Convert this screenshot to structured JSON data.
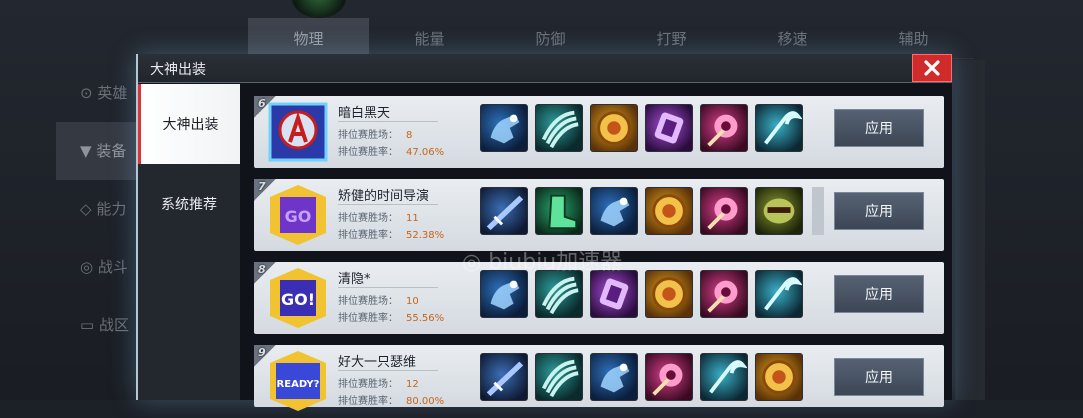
{
  "background": {
    "tabs": [
      "物理",
      "能量",
      "防御",
      "打野",
      "移速",
      "辅助"
    ],
    "side_items": [
      "英雄",
      "装备",
      "能力",
      "战斗",
      "战区"
    ]
  },
  "dialog": {
    "title": "大神出装",
    "close_icon": "close-icon",
    "nav": [
      "大神出装",
      "系统推荐"
    ]
  },
  "builds": [
    {
      "rank": "6",
      "name": "暗白黑天",
      "games_label": "排位赛胜场：",
      "games": "8",
      "winrate_label": "排位赛胜率：",
      "winrate": "47.06%",
      "avatar": "avengers-badge",
      "items": [
        "gauntlet",
        "claw",
        "coin",
        "purple",
        "pink",
        "scythe"
      ],
      "apply": "应用"
    },
    {
      "rank": "7",
      "name": "矫健的时间导演",
      "games_label": "排位赛胜场：",
      "games": "11",
      "winrate_label": "排位赛胜率：",
      "winrate": "52.38%",
      "avatar": "go-badge-purple",
      "items": [
        "blade",
        "boot",
        "gauntlet",
        "coin",
        "pink",
        "mask"
      ],
      "apply": "应用"
    },
    {
      "rank": "8",
      "name": "清隐*",
      "games_label": "排位赛胜场：",
      "games": "10",
      "winrate_label": "排位赛胜率：",
      "winrate": "55.56%",
      "avatar": "go-badge-blue",
      "items": [
        "gauntlet",
        "claw",
        "purple",
        "coin",
        "pink",
        "scythe"
      ],
      "apply": "应用"
    },
    {
      "rank": "9",
      "name": "好大一只瑟维",
      "games_label": "排位赛胜场：",
      "games": "12",
      "winrate_label": "排位赛胜率：",
      "winrate": "80.00%",
      "avatar": "ready-badge",
      "items": [
        "blade",
        "claw",
        "gauntlet",
        "pink",
        "scythe",
        "coin"
      ],
      "apply": "应用"
    }
  ],
  "watermark": "biubiu加速器"
}
